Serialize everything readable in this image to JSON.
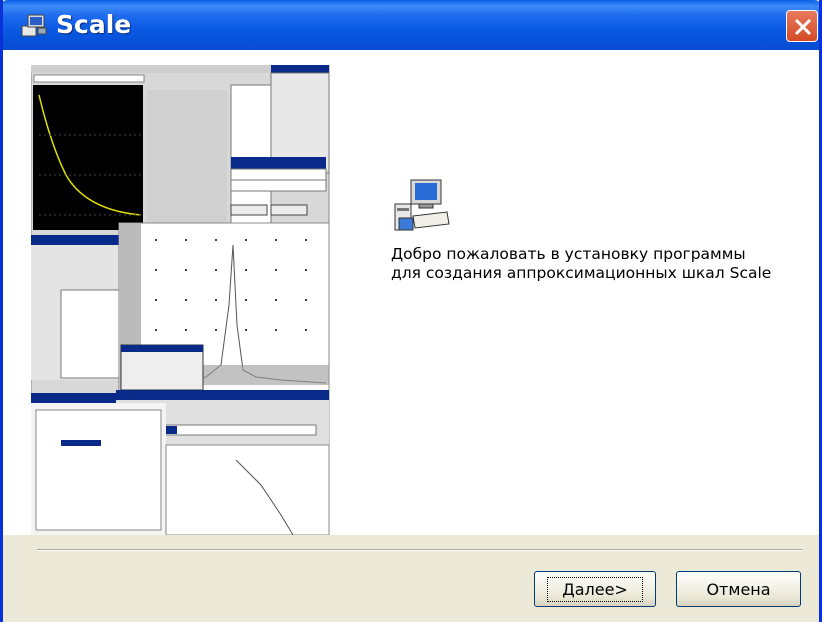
{
  "window": {
    "title": "Scale"
  },
  "welcome": {
    "line1": "Добро пожаловать в установку программы",
    "line2": "для создания аппроксимационных шкал Scale"
  },
  "buttons": {
    "next_mnemonic": "Д",
    "next_rest": "алее>",
    "cancel": "Отмена"
  },
  "icons": {
    "title": "installer-icon",
    "close": "close-icon",
    "welcome": "setup-computer-icon"
  },
  "colors": {
    "titlebar": "#0a59e3",
    "close": "#d44a26",
    "dialog": "#ece9d8"
  }
}
